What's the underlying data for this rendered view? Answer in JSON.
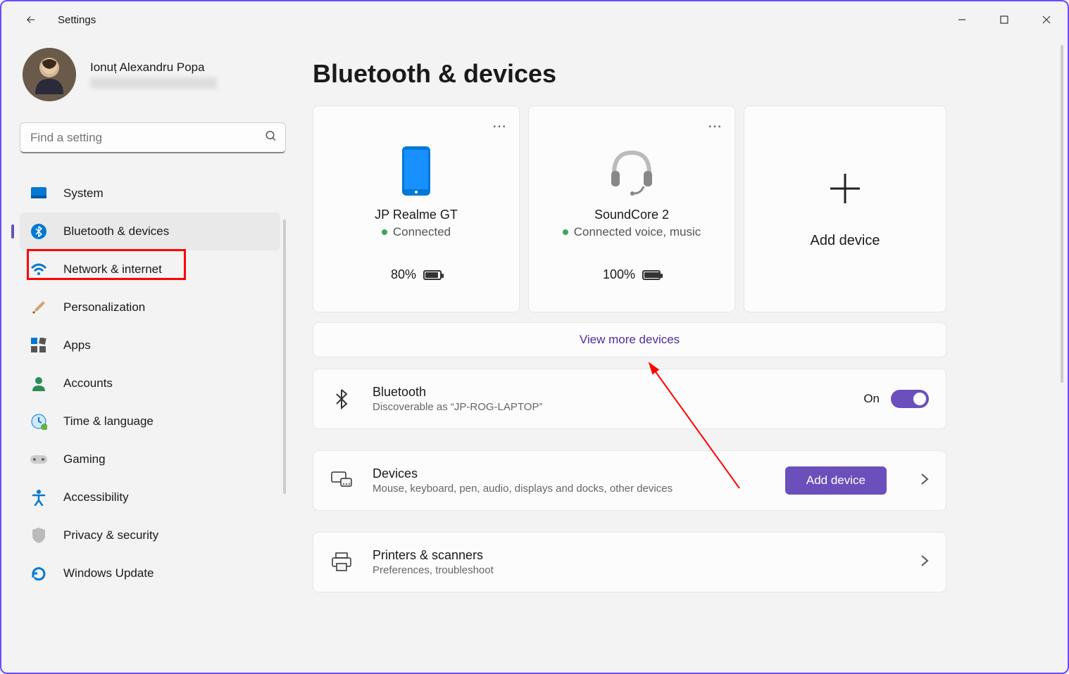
{
  "window": {
    "title": "Settings"
  },
  "profile": {
    "name": "Ionuț Alexandru Popa",
    "email": "redacted"
  },
  "search": {
    "placeholder": "Find a setting"
  },
  "nav": {
    "items": [
      {
        "label": "System",
        "icon": "system"
      },
      {
        "label": "Bluetooth & devices",
        "icon": "bluetooth",
        "active": true
      },
      {
        "label": "Network & internet",
        "icon": "wifi"
      },
      {
        "label": "Personalization",
        "icon": "brush"
      },
      {
        "label": "Apps",
        "icon": "apps"
      },
      {
        "label": "Accounts",
        "icon": "person"
      },
      {
        "label": "Time & language",
        "icon": "clock"
      },
      {
        "label": "Gaming",
        "icon": "gamepad"
      },
      {
        "label": "Accessibility",
        "icon": "accessibility"
      },
      {
        "label": "Privacy & security",
        "icon": "shield"
      },
      {
        "label": "Windows Update",
        "icon": "update"
      }
    ]
  },
  "page": {
    "title": "Bluetooth & devices"
  },
  "devices": [
    {
      "name": "JP Realme GT",
      "status": "Connected",
      "battery": "80%",
      "battery_fill": 80,
      "type": "phone"
    },
    {
      "name": "SoundCore 2",
      "status": "Connected voice, music",
      "battery": "100%",
      "battery_fill": 100,
      "type": "headset"
    }
  ],
  "add_device": {
    "label": "Add device"
  },
  "view_more": "View more devices",
  "bluetooth_row": {
    "title": "Bluetooth",
    "subtitle": "Discoverable as “JP-ROG-LAPTOP”",
    "toggle_label": "On"
  },
  "devices_row": {
    "title": "Devices",
    "subtitle": "Mouse, keyboard, pen, audio, displays and docks, other devices",
    "button": "Add device"
  },
  "printers_row": {
    "title": "Printers & scanners",
    "subtitle": "Preferences, troubleshoot"
  },
  "colors": {
    "accent": "#6b4fbb"
  }
}
